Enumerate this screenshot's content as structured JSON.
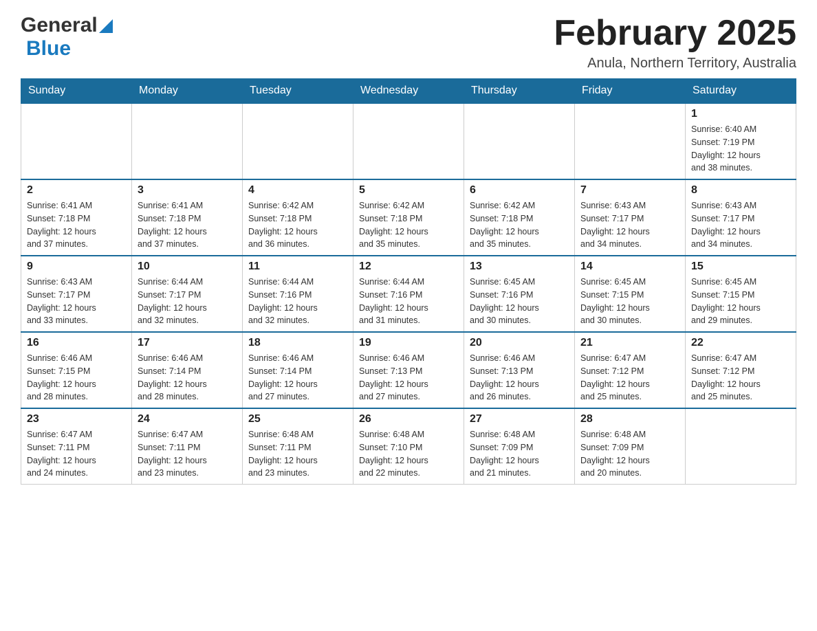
{
  "header": {
    "logo_general": "General",
    "logo_blue": "Blue",
    "month_title": "February 2025",
    "subtitle": "Anula, Northern Territory, Australia"
  },
  "days_of_week": [
    "Sunday",
    "Monday",
    "Tuesday",
    "Wednesday",
    "Thursday",
    "Friday",
    "Saturday"
  ],
  "weeks": [
    [
      {
        "day": "",
        "info": ""
      },
      {
        "day": "",
        "info": ""
      },
      {
        "day": "",
        "info": ""
      },
      {
        "day": "",
        "info": ""
      },
      {
        "day": "",
        "info": ""
      },
      {
        "day": "",
        "info": ""
      },
      {
        "day": "1",
        "info": "Sunrise: 6:40 AM\nSunset: 7:19 PM\nDaylight: 12 hours\nand 38 minutes."
      }
    ],
    [
      {
        "day": "2",
        "info": "Sunrise: 6:41 AM\nSunset: 7:18 PM\nDaylight: 12 hours\nand 37 minutes."
      },
      {
        "day": "3",
        "info": "Sunrise: 6:41 AM\nSunset: 7:18 PM\nDaylight: 12 hours\nand 37 minutes."
      },
      {
        "day": "4",
        "info": "Sunrise: 6:42 AM\nSunset: 7:18 PM\nDaylight: 12 hours\nand 36 minutes."
      },
      {
        "day": "5",
        "info": "Sunrise: 6:42 AM\nSunset: 7:18 PM\nDaylight: 12 hours\nand 35 minutes."
      },
      {
        "day": "6",
        "info": "Sunrise: 6:42 AM\nSunset: 7:18 PM\nDaylight: 12 hours\nand 35 minutes."
      },
      {
        "day": "7",
        "info": "Sunrise: 6:43 AM\nSunset: 7:17 PM\nDaylight: 12 hours\nand 34 minutes."
      },
      {
        "day": "8",
        "info": "Sunrise: 6:43 AM\nSunset: 7:17 PM\nDaylight: 12 hours\nand 34 minutes."
      }
    ],
    [
      {
        "day": "9",
        "info": "Sunrise: 6:43 AM\nSunset: 7:17 PM\nDaylight: 12 hours\nand 33 minutes."
      },
      {
        "day": "10",
        "info": "Sunrise: 6:44 AM\nSunset: 7:17 PM\nDaylight: 12 hours\nand 32 minutes."
      },
      {
        "day": "11",
        "info": "Sunrise: 6:44 AM\nSunset: 7:16 PM\nDaylight: 12 hours\nand 32 minutes."
      },
      {
        "day": "12",
        "info": "Sunrise: 6:44 AM\nSunset: 7:16 PM\nDaylight: 12 hours\nand 31 minutes."
      },
      {
        "day": "13",
        "info": "Sunrise: 6:45 AM\nSunset: 7:16 PM\nDaylight: 12 hours\nand 30 minutes."
      },
      {
        "day": "14",
        "info": "Sunrise: 6:45 AM\nSunset: 7:15 PM\nDaylight: 12 hours\nand 30 minutes."
      },
      {
        "day": "15",
        "info": "Sunrise: 6:45 AM\nSunset: 7:15 PM\nDaylight: 12 hours\nand 29 minutes."
      }
    ],
    [
      {
        "day": "16",
        "info": "Sunrise: 6:46 AM\nSunset: 7:15 PM\nDaylight: 12 hours\nand 28 minutes."
      },
      {
        "day": "17",
        "info": "Sunrise: 6:46 AM\nSunset: 7:14 PM\nDaylight: 12 hours\nand 28 minutes."
      },
      {
        "day": "18",
        "info": "Sunrise: 6:46 AM\nSunset: 7:14 PM\nDaylight: 12 hours\nand 27 minutes."
      },
      {
        "day": "19",
        "info": "Sunrise: 6:46 AM\nSunset: 7:13 PM\nDaylight: 12 hours\nand 27 minutes."
      },
      {
        "day": "20",
        "info": "Sunrise: 6:46 AM\nSunset: 7:13 PM\nDaylight: 12 hours\nand 26 minutes."
      },
      {
        "day": "21",
        "info": "Sunrise: 6:47 AM\nSunset: 7:12 PM\nDaylight: 12 hours\nand 25 minutes."
      },
      {
        "day": "22",
        "info": "Sunrise: 6:47 AM\nSunset: 7:12 PM\nDaylight: 12 hours\nand 25 minutes."
      }
    ],
    [
      {
        "day": "23",
        "info": "Sunrise: 6:47 AM\nSunset: 7:11 PM\nDaylight: 12 hours\nand 24 minutes."
      },
      {
        "day": "24",
        "info": "Sunrise: 6:47 AM\nSunset: 7:11 PM\nDaylight: 12 hours\nand 23 minutes."
      },
      {
        "day": "25",
        "info": "Sunrise: 6:48 AM\nSunset: 7:11 PM\nDaylight: 12 hours\nand 23 minutes."
      },
      {
        "day": "26",
        "info": "Sunrise: 6:48 AM\nSunset: 7:10 PM\nDaylight: 12 hours\nand 22 minutes."
      },
      {
        "day": "27",
        "info": "Sunrise: 6:48 AM\nSunset: 7:09 PM\nDaylight: 12 hours\nand 21 minutes."
      },
      {
        "day": "28",
        "info": "Sunrise: 6:48 AM\nSunset: 7:09 PM\nDaylight: 12 hours\nand 20 minutes."
      },
      {
        "day": "",
        "info": ""
      }
    ]
  ]
}
